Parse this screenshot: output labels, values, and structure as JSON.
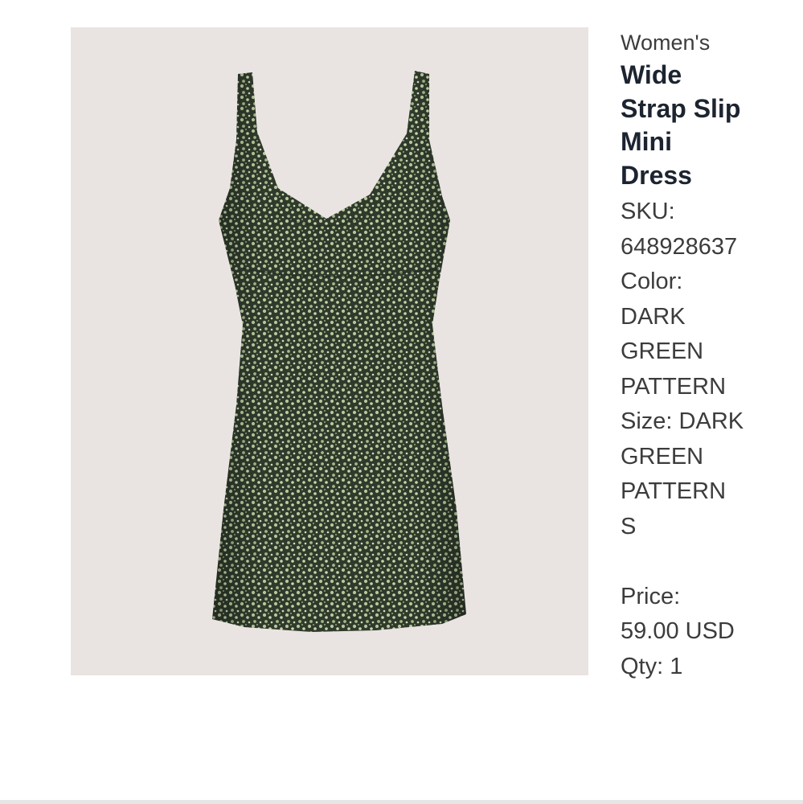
{
  "product": {
    "image_icon": "dress-photo",
    "category": "Women's",
    "title_lines": [
      "Wide",
      "Strap Slip",
      "Mini",
      "Dress"
    ],
    "sku_label": "SKU:",
    "sku_value": "648928637",
    "color_label": "Color:",
    "color_lines": [
      "DARK",
      "GREEN",
      "PATTERN"
    ],
    "size_lines": [
      "Size: DARK",
      "GREEN",
      "PATTERN",
      "S"
    ],
    "price_label": "Price:",
    "price_value": "59.00 USD",
    "qty": "Qty: 1"
  },
  "colors": {
    "image_background": "#e9e4e1",
    "dress_base": "#2f3a2c",
    "dress_print": "#b8c79a",
    "title_text": "#1c2430",
    "body_text": "#3c3c3c"
  }
}
